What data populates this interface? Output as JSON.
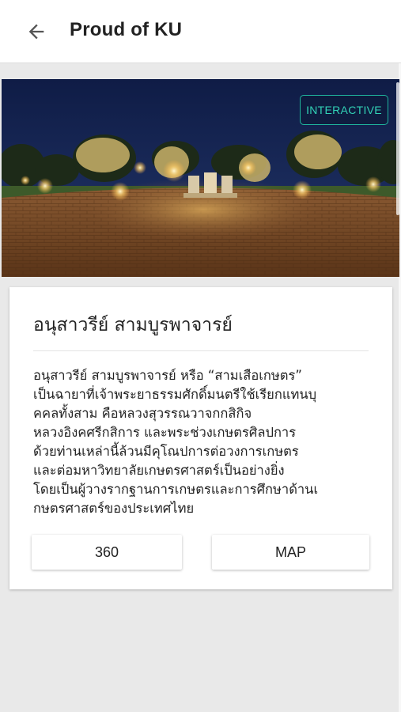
{
  "header": {
    "title": "Proud of KU",
    "back_icon": "arrow-left-icon"
  },
  "panorama": {
    "badge_label": "INTERACTIVE"
  },
  "card": {
    "title": "อนุสาวรีย์ สามบูรพาจารย์",
    "description_lines": [
      "อนุสาวรีย์ สามบูรพาจารย์ หรือ “สามเสือเกษตร”",
      "เป็นฉายาที่เจ้าพระยาธรรมศักดิ์มนตรีใช้เรียกแทนบุ",
      "คคลทั้งสาม คือหลวงสุวรรณวาจกกสิกิจ",
      "หลวงอิงคศรีกสิการ และพระช่วงเกษตรศิลปการ",
      "ด้วยท่านเหล่านี้ล้วนมีคุโณปการต่อวงการเกษตร",
      "และต่อมหาวิทยาลัยเกษตรศาสตร์เป็นอย่างยิ่ง",
      "โดยเป็นผู้วางรากฐานการเกษตรและการศึกษาด้านเ",
      "กษตรศาสตร์ของประเทศไทย"
    ],
    "button_360": "360",
    "button_map": "MAP"
  },
  "colors": {
    "accent": "#1fb59d",
    "background": "#e9e9e9"
  }
}
